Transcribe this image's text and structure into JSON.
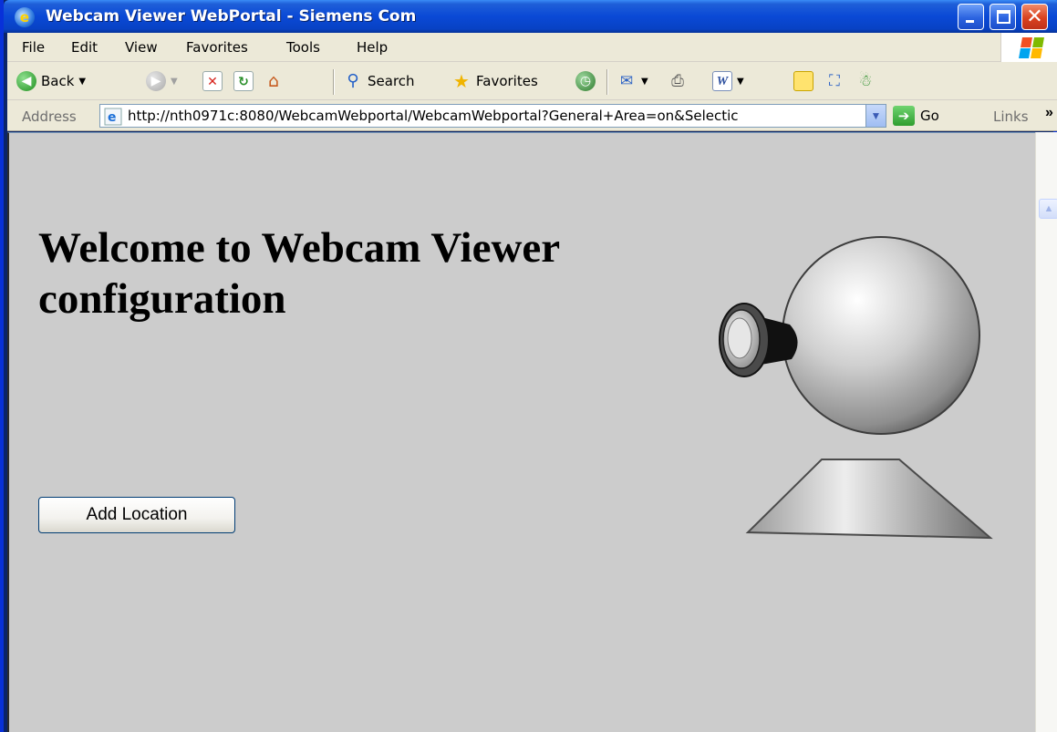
{
  "window": {
    "title": "Webcam Viewer WebPortal - Siemens Com",
    "controls": {
      "minimize_icon": "minimize-icon",
      "maximize_icon": "maximize-icon",
      "close_icon": "close-icon"
    }
  },
  "menu": {
    "items": [
      "File",
      "Edit",
      "View",
      "Favorites",
      "Tools",
      "Help"
    ]
  },
  "toolbar": {
    "back_label": "Back",
    "search_label": "Search",
    "favorites_label": "Favorites"
  },
  "address_bar": {
    "label": "Address",
    "url": "http://nth0971c:8080/WebcamWebportal/WebcamWebportal?General+Area=on&Selectic",
    "go_label": "Go",
    "links_label": "Links",
    "links_chevron": "»"
  },
  "page": {
    "heading": "Welcome to Webcam Viewer configuration",
    "add_location_label": "Add Location"
  },
  "colors": {
    "page_background": "#cccccc",
    "titlebar_blue": "#0a49d6",
    "chrome_beige": "#ece9d8"
  }
}
